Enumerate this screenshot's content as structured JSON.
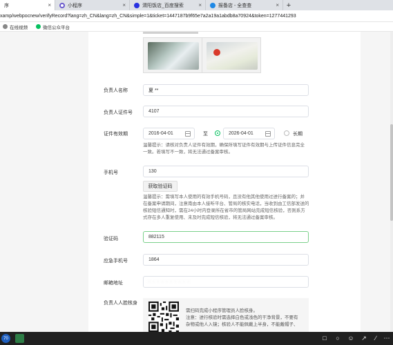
{
  "browser": {
    "tabs": [
      {
        "title": "序",
        "active": true
      },
      {
        "title": "小程序",
        "active": false
      },
      {
        "title": "渭阳饭店_百度搜索",
        "active": false
      },
      {
        "title": "报备店 - 全查查",
        "active": false
      }
    ],
    "new_tab": "+",
    "url": "xamp/webpocnew/verifyRecord?lang=zh_CN&lang=zh_CN&simple=1&ticket=1447187b9f65e7a2a19a1abdb8a70924&token=1277441293",
    "bookmarks": [
      {
        "label": "在线视频",
        "color": "#888888"
      },
      {
        "label": "微信公众平台",
        "color": "#07c160"
      }
    ]
  },
  "form": {
    "person_name": {
      "label": "负责人名称",
      "value": "夏 **"
    },
    "id_number": {
      "label": "负责人证件号",
      "value": "4107"
    },
    "validity": {
      "label": "证件有效期",
      "start": "2016-04-01",
      "to": "至",
      "end": "2026-04-01",
      "long_term": "长期"
    },
    "validity_tip": [
      "温馨提示：请核对负责人证件有效期，确保所填写证件有效期与上传证件信息完全",
      "一致。若填写不一致，将无法通过备案审核。"
    ],
    "phone": {
      "label": "手机号",
      "value": "130"
    },
    "get_code_button": "获取验证码",
    "phone_tip": [
      "温馨提示：需填写本人使用的有效手机号码，且没有他其他使用过进行备案的；并",
      "在备案申请期间，注意南由本人接听平台、管局的核实电话，当收到由工信部发送的",
      "核验短信通知时，需在24小时内登录所在省市的管局网站完成短信核验，否则系方",
      "式存在多人重复使用、未及时完成短信核验，将无法通过备案审核。"
    ],
    "verify_code": {
      "label": "验证码",
      "value": "882115"
    },
    "emergency_phone": {
      "label": "应急手机号",
      "value": "1864"
    },
    "email": {
      "label": "邮箱地址",
      "value": "· · · · · · · · · ·"
    },
    "face_verify": {
      "label": "负责人人脸核身",
      "desc": [
        "需扫码完成小程序管理员人脸核身。",
        "注意：进行核验时需选择白色或浅色的干净背景，不要有",
        "杂物或他人入镜；核验人不能佩戴上半身，不能戴帽子、",
        "眼镜、口罩等遮挡面部的物品，保持表情自然，五官平"
      ]
    }
  },
  "taskbar": {
    "badge": "70"
  },
  "colors": {
    "accent_green": "#07c160",
    "focus_border": "#7ad08a"
  }
}
